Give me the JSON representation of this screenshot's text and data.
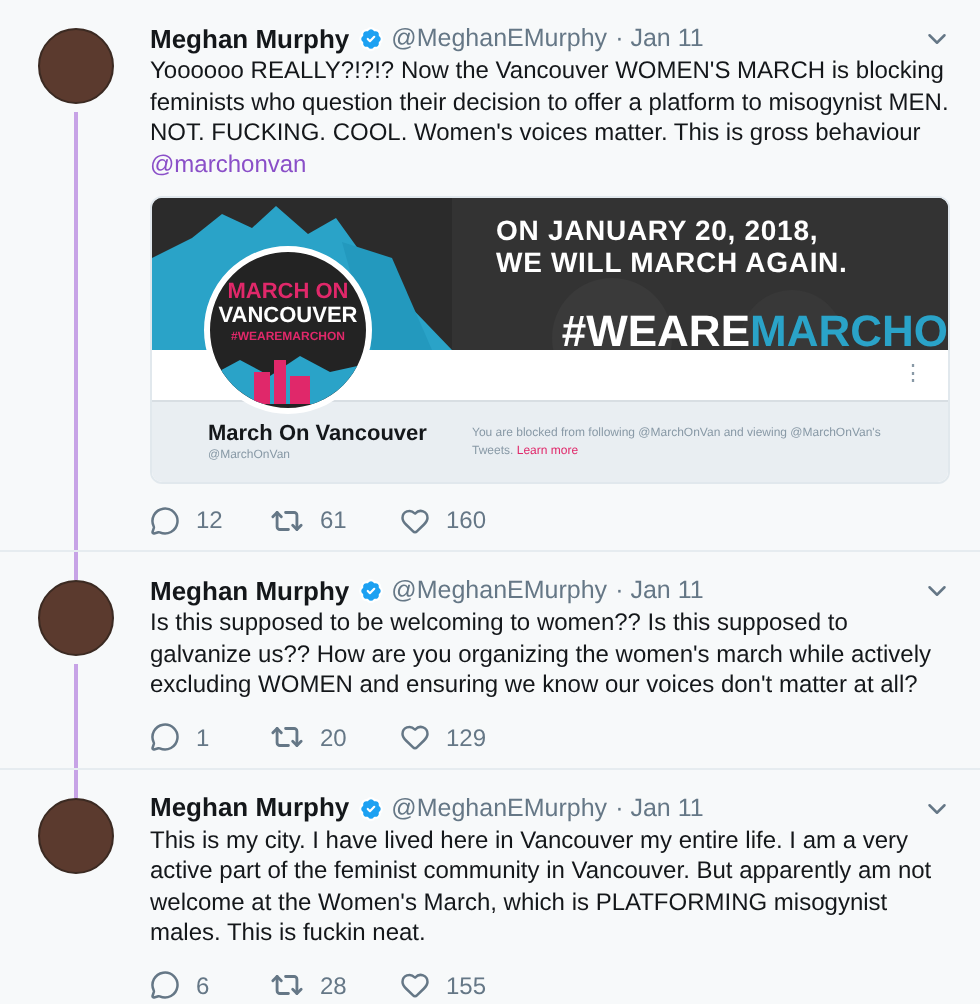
{
  "tweets": [
    {
      "author": "Meghan Murphy",
      "verified": true,
      "handle": "@MeghanEMurphy",
      "date": "· Jan 11",
      "text": "Yoooooo REALLY?!?!? Now the Vancouver WOMEN'S MARCH is blocking feminists who question their decision to offer a platform to misogynist MEN. NOT. FUCKING. COOL. Women's voices matter. This is gross behaviour",
      "mention": "@marchonvan",
      "thread_below": true,
      "card": {
        "banner_lines": [
          "ON JANUARY 20, 2018,",
          "WE WILL MARCH AGAIN."
        ],
        "hashtag_parts": [
          "#WEARE",
          "MARCHO"
        ],
        "logo_lines": [
          "MARCH ON",
          "VANCOUVER",
          "#WEAREMARCHON"
        ],
        "more": "⋮",
        "name": "March On Vancouver",
        "handle": "@MarchOnVan",
        "notice": "You are blocked from following @MarchOnVan and viewing @MarchOnVan's Tweets.",
        "link": "Learn more"
      },
      "replies": "12",
      "retweets": "61",
      "likes": "160"
    },
    {
      "author": "Meghan Murphy",
      "verified": true,
      "handle": "@MeghanEMurphy",
      "date": "· Jan 11",
      "text": "Is this supposed to be welcoming to women?? Is this supposed to galvanize us?? How are you organizing the women's march while actively excluding WOMEN and ensuring we know our voices don't matter at all?",
      "thread_below": true,
      "replies": "1",
      "retweets": "20",
      "likes": "129"
    },
    {
      "author": "Meghan Murphy",
      "verified": true,
      "handle": "@MeghanEMurphy",
      "date": "· Jan 11",
      "text": "This is my city. I have lived here in Vancouver my entire life. I am a very active part of the feminist community in Vancouver. But apparently am not welcome at the Women's March, which is PLATFORMING misogynist males. This is fuckin neat.",
      "thread_below": false,
      "replies": "6",
      "retweets": "28",
      "likes": "155"
    }
  ]
}
